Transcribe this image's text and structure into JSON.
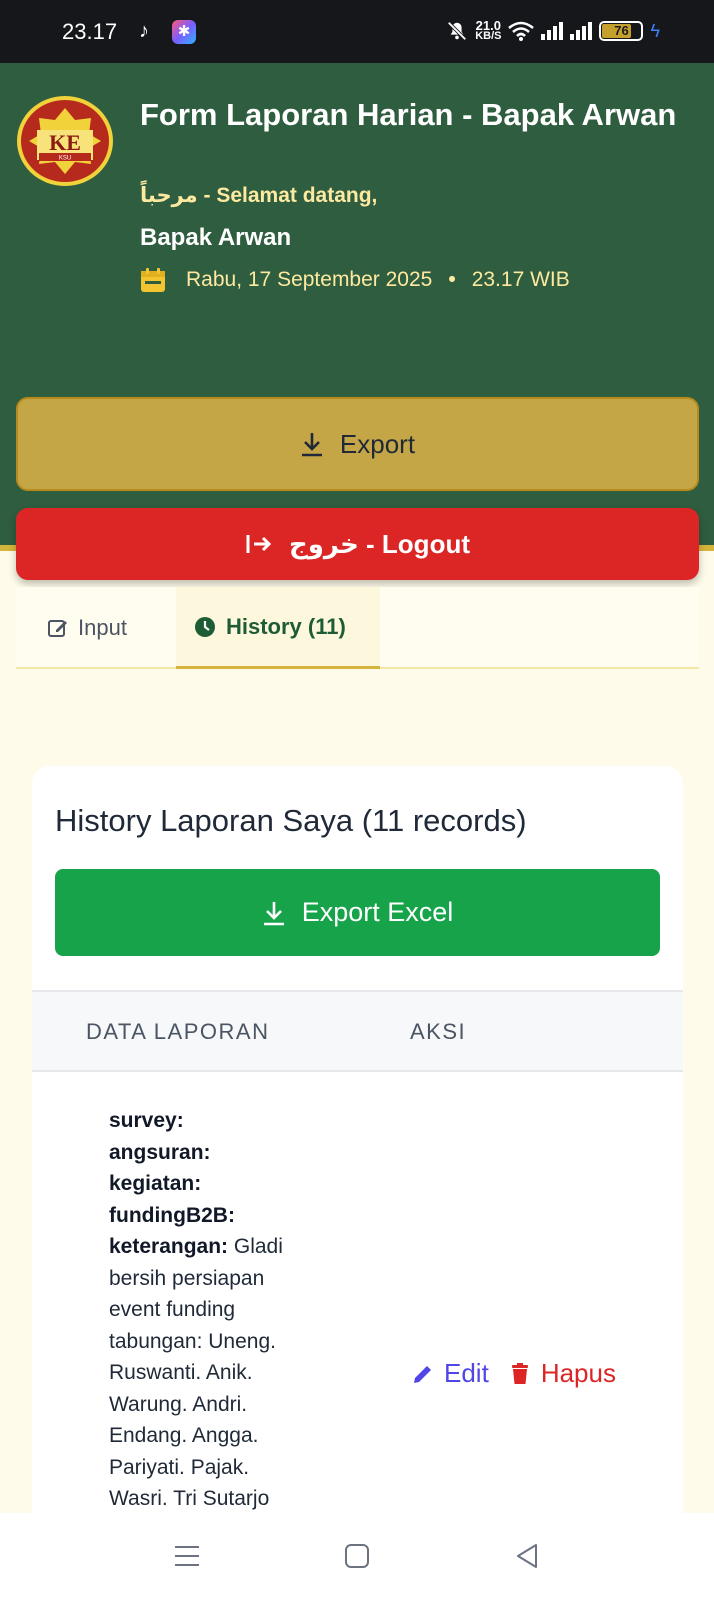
{
  "status_bar": {
    "time": "23.17",
    "net_speed_value": "21.0",
    "net_speed_unit": "KB/S",
    "battery": "76",
    "icons": [
      "tiktok-icon",
      "app-icon",
      "mute-icon",
      "wifi-icon",
      "signal-icon",
      "battery-icon",
      "charging-icon"
    ]
  },
  "header": {
    "logo_text": "KE",
    "logo_subtext": "KSU",
    "title": "Form Laporan Harian - Bapak Arwan",
    "welcome": "مرحباً - Selamat datang,",
    "user_name": "Bapak Arwan",
    "date": "Rabu, 17 September 2025",
    "time": "23.17 WIB",
    "export_label": "Export",
    "logout_label": "خروج - Logout"
  },
  "tabs": [
    {
      "label": "Input",
      "active": false
    },
    {
      "label": "History (11)",
      "active": true
    }
  ],
  "history": {
    "title": "History Laporan Saya (11 records)",
    "export_excel_label": "Export Excel",
    "columns": [
      "DATA LAPORAN",
      "AKSI"
    ],
    "rows": [
      {
        "fields": [
          {
            "key": "survey:",
            "value": ""
          },
          {
            "key": "angsuran:",
            "value": ""
          },
          {
            "key": "kegiatan:",
            "value": ""
          },
          {
            "key": "fundingB2B:",
            "value": ""
          },
          {
            "key": "keterangan:",
            "value": " Gladi bersih persiapan event funding tabungan: Uneng. Ruswanti. Anik. Warung. Andri. Endang. Angga. Pariyati. Pajak. Wasri. Tri Sutarjo"
          }
        ],
        "edit_label": "Edit",
        "delete_label": "Hapus"
      }
    ]
  },
  "colors": {
    "header_bg": "#2f5d3f",
    "accent_gold": "#d4b43a",
    "export_bg": "#c5a646",
    "logout_bg": "#dc2626",
    "excel_bg": "#16a34a",
    "edit_color": "#4f46e5",
    "page_bg": "#fefbea"
  }
}
